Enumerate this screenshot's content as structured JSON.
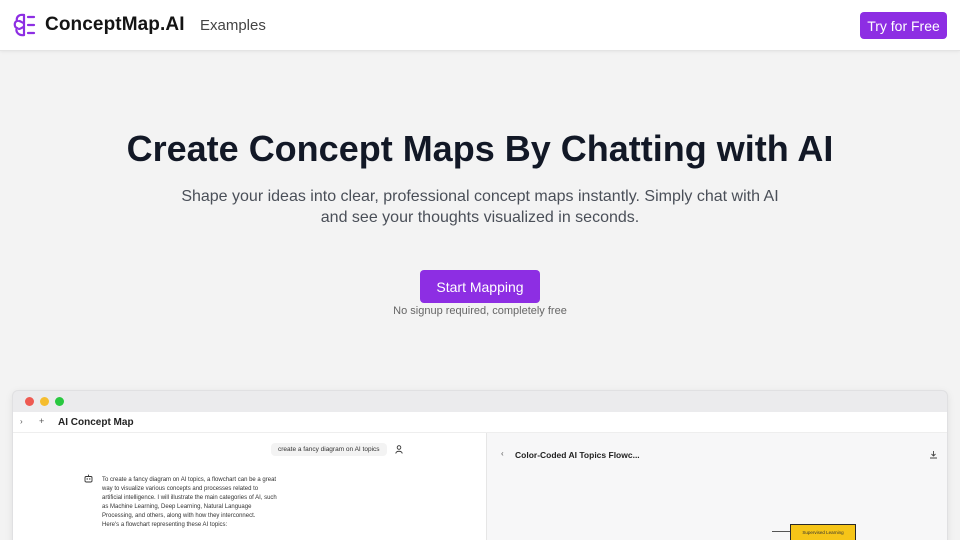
{
  "nav": {
    "brand": "ConceptMap.AI",
    "examples_link": "Examples",
    "cta_label": "Try for Free",
    "logo_icon": "brain-icon"
  },
  "hero": {
    "title": "Create Concept Maps By Chatting with AI",
    "subtitle_line1": "Shape your ideas into clear, professional concept maps instantly. Simply chat with AI",
    "subtitle_line2": "and see your thoughts visualized in seconds.",
    "start_button": "Start Mapping",
    "note": "No signup required, completely free"
  },
  "preview": {
    "app_title": "AI Concept Map",
    "user_message": "create a fancy diagram on AI topics",
    "bot_message": [
      "To create a fancy diagram on AI topics, a flowchart can be a great",
      "way to visualize various concepts and processes related to",
      "artificial intelligence. I will illustrate the main categories of AI, such",
      "as Machine Learning, Deep Learning, Natural Language",
      "Processing, and others, along with how they interconnect.",
      "Here's a flowchart representing these AI topics:"
    ],
    "flow_title": "Color-Coded AI Topics Flowc...",
    "node_label": "Supervised Learning"
  },
  "colors": {
    "accent": "#8d2ee3",
    "background": "#f3f3f3",
    "node_fill": "#f6c518"
  }
}
